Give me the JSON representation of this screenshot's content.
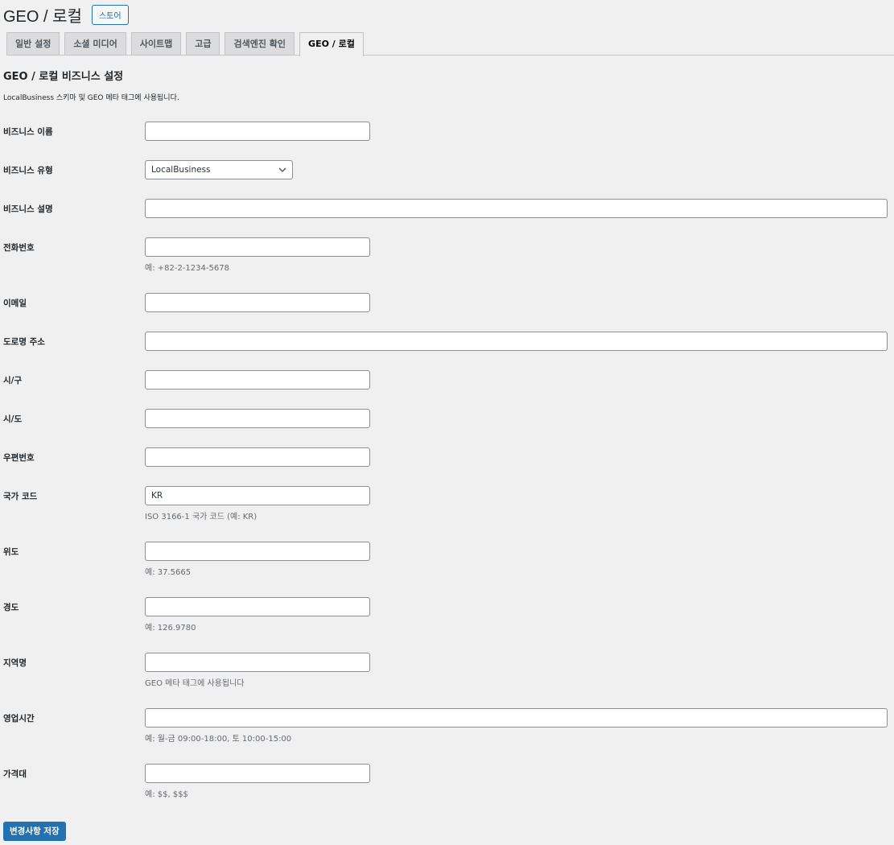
{
  "header": {
    "title": "GEO / 로컬",
    "store_button": "스토어"
  },
  "tabs": [
    "일반 설정",
    "소셜 미디어",
    "사이트맵",
    "고급",
    "검색엔진 확인",
    "GEO / 로컬"
  ],
  "section": {
    "title": "GEO / 로컬 비즈니스 설정",
    "description": "LocalBusiness 스키마 및 GEO 메타 태그에 사용됩니다."
  },
  "fields": [
    {
      "label": "비즈니스 이름",
      "value": "",
      "hint": ""
    },
    {
      "label": "비즈니스 유형",
      "value": "LocalBusiness",
      "hint": ""
    },
    {
      "label": "비즈니스 설명",
      "value": "",
      "hint": ""
    },
    {
      "label": "전화번호",
      "value": "",
      "hint": "예: +82-2-1234-5678"
    },
    {
      "label": "이메일",
      "value": "",
      "hint": ""
    },
    {
      "label": "도로명 주소",
      "value": "",
      "hint": ""
    },
    {
      "label": "시/구",
      "value": "",
      "hint": ""
    },
    {
      "label": "시/도",
      "value": "",
      "hint": ""
    },
    {
      "label": "우편번호",
      "value": "",
      "hint": ""
    },
    {
      "label": "국가 코드",
      "value": "KR",
      "hint": "ISO 3166-1 국가 코드 (예: KR)"
    },
    {
      "label": "위도",
      "value": "",
      "hint": "예: 37.5665"
    },
    {
      "label": "경도",
      "value": "",
      "hint": "예: 126.9780"
    },
    {
      "label": "지역명",
      "value": "",
      "hint": "GEO 메타 태그에 사용됩니다"
    },
    {
      "label": "영업시간",
      "value": "",
      "hint": "예: 월-금 09:00-18:00, 토 10:00-15:00"
    },
    {
      "label": "가격대",
      "value": "",
      "hint": "예: $$, $$$"
    }
  ],
  "save_button": "변경사항 저장"
}
